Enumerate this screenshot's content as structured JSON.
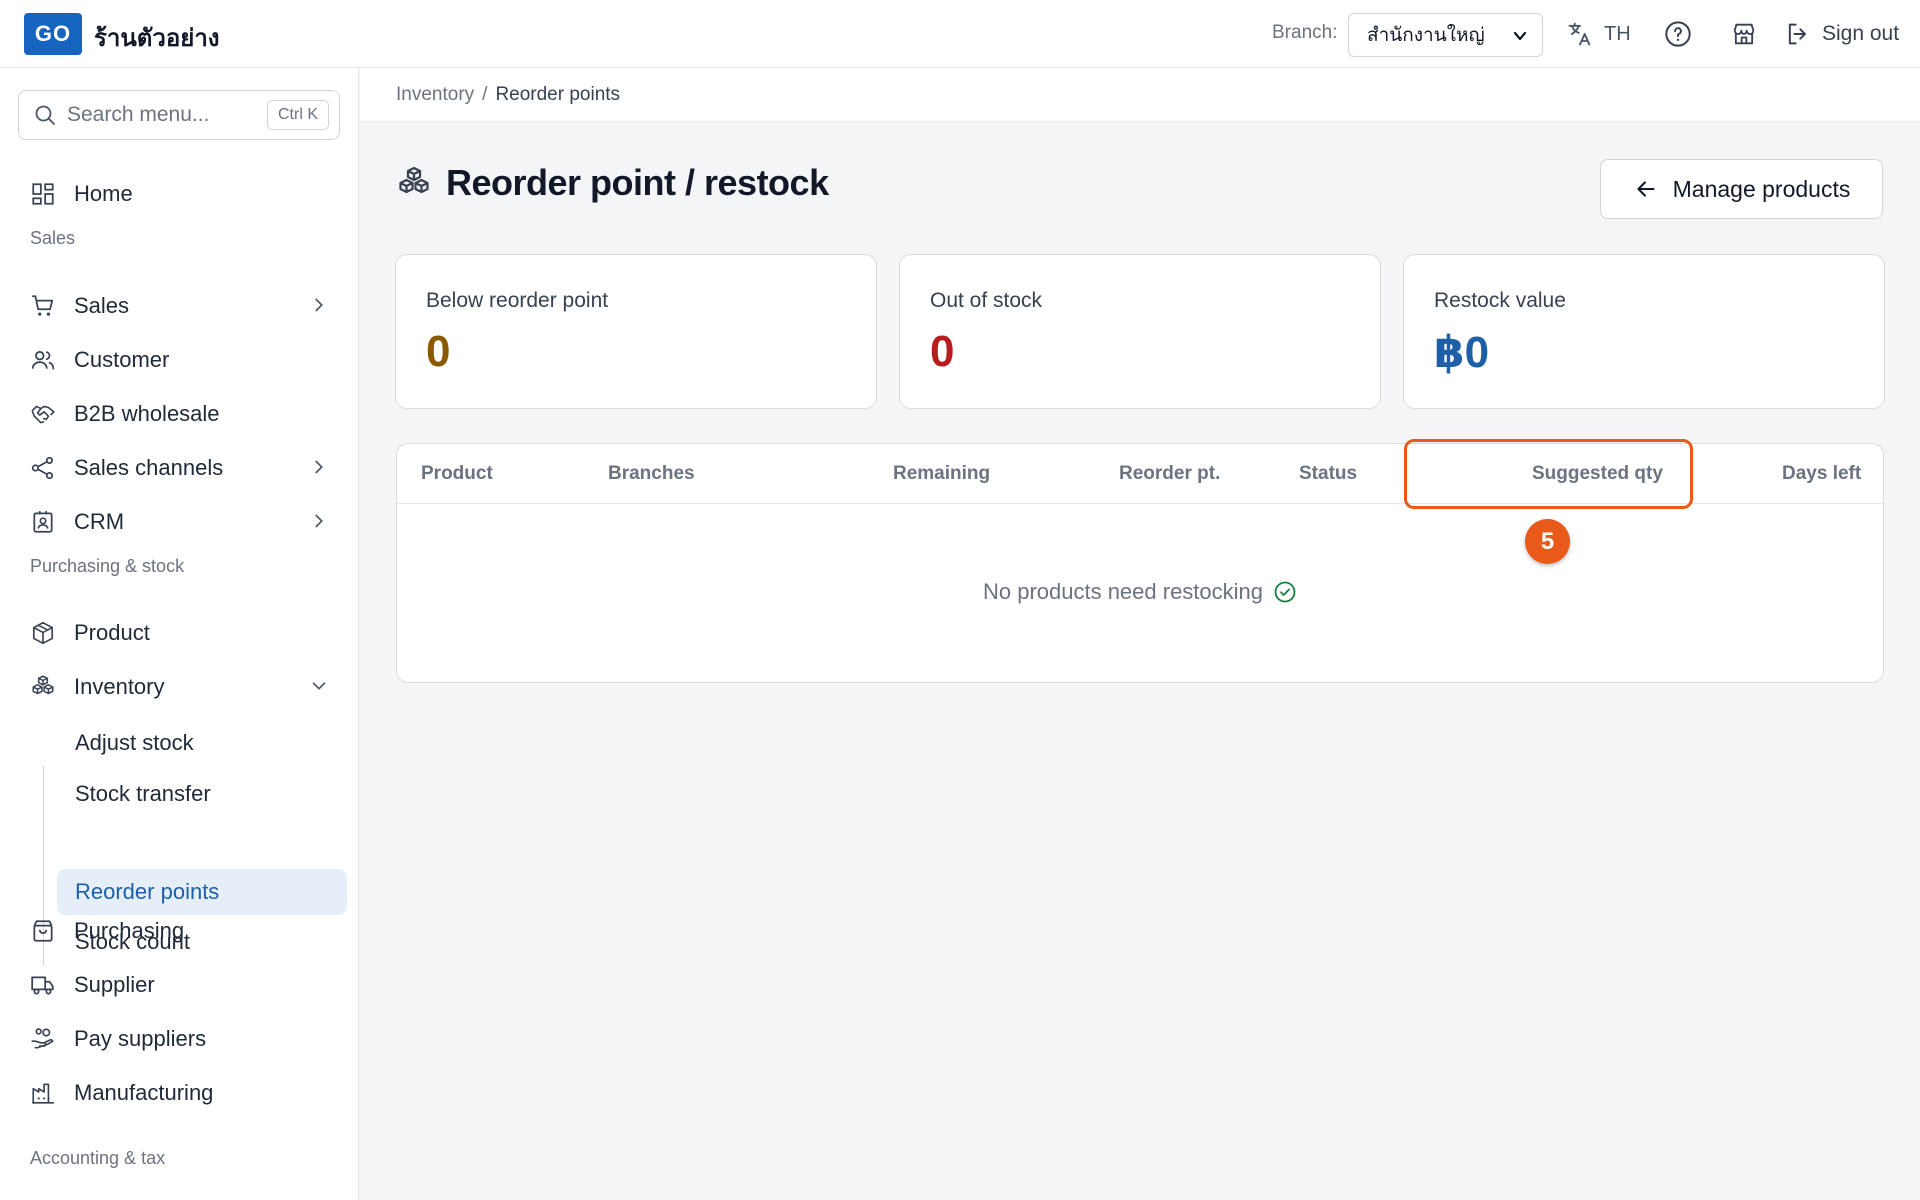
{
  "header": {
    "logo": "GO",
    "shop_name": "ร้านตัวอย่าง",
    "branch_label": "Branch:",
    "branch_value": "สำนักงานใหญ่",
    "language": "TH",
    "sign_out": "Sign out"
  },
  "sidebar": {
    "search_placeholder": "Search menu...",
    "search_shortcut": "Ctrl K",
    "home": "Home",
    "section_sales": "Sales",
    "sales": "Sales",
    "customer": "Customer",
    "b2b": "B2B wholesale",
    "sales_channels": "Sales channels",
    "crm": "CRM",
    "section_purchasing": "Purchasing & stock",
    "product": "Product",
    "inventory": "Inventory",
    "inventory_sub": [
      "Adjust stock",
      "Stock transfer",
      "Reorder points",
      "Stock count"
    ],
    "purchasing": "Purchasing",
    "supplier": "Supplier",
    "pay_suppliers": "Pay suppliers",
    "manufacturing": "Manufacturing",
    "section_accounting": "Accounting & tax"
  },
  "breadcrumb": {
    "parent": "Inventory",
    "separator": "/",
    "current": "Reorder points"
  },
  "page": {
    "title": "Reorder point / restock",
    "manage_button": "Manage products"
  },
  "stats": [
    {
      "label": "Below reorder point",
      "value": "0",
      "color": "#8a5a00"
    },
    {
      "label": "Out of stock",
      "value": "0",
      "color": "#b91c1c"
    },
    {
      "label": "Restock value",
      "value": "฿0",
      "color": "#1f5fa8"
    }
  ],
  "table": {
    "columns": [
      "Product",
      "Branches",
      "Remaining",
      "Reorder pt.",
      "Status",
      "Suggested qty",
      "Days left"
    ],
    "empty_message": "No products need restocking"
  },
  "annotation": {
    "step": "5",
    "color": "#e8591a"
  }
}
